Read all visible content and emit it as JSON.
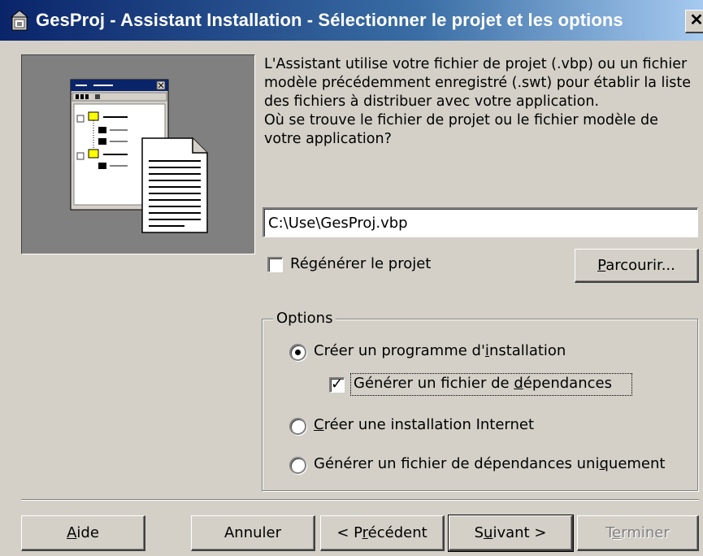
{
  "window": {
    "title": "GesProj - Assistant Installation - Sélectionner le projet et les options",
    "close_glyph": "✕"
  },
  "description": {
    "paragraph1": "L'Assistant utilise votre fichier de projet (.vbp) ou un fichier modèle précédemment enregistré (.swt) pour établir la liste des fichiers à distribuer avec votre application.",
    "paragraph2": "Où se trouve le fichier de projet ou le fichier modèle de votre application?"
  },
  "project_path": {
    "value": "C:\\Use\\GesProj.vbp"
  },
  "rebuild": {
    "label_pre": "Ré",
    "label_accel": "g",
    "label_post": "énérer le projet",
    "checked": false
  },
  "browse_button": {
    "label_accel": "P",
    "label_post": "arcourir..."
  },
  "options": {
    "title": "Options",
    "create_setup": {
      "label_pre": "Créer un programme d'",
      "label_accel": "i",
      "label_post": "nstallation",
      "selected": true
    },
    "gen_dependency": {
      "label_pre": "Générer un fichier de ",
      "label_accel": "d",
      "label_post": "épendances",
      "checked": true
    },
    "internet_setup": {
      "label_accel": "C",
      "label_post": "réer une installation Internet",
      "selected": false
    },
    "dependency_only": {
      "label_pre": "Générer un fichier de dépendances uni",
      "label_accel": "q",
      "label_post": "uement",
      "selected": false
    }
  },
  "buttons": {
    "help": {
      "label_accel": "A",
      "label_post": "ide"
    },
    "cancel": {
      "label": "Annuler"
    },
    "previous": {
      "label_pre": "< P",
      "label_accel": "r",
      "label_post": "écédent"
    },
    "next": {
      "label_pre": "S",
      "label_accel": "u",
      "label_post": "ivant >"
    },
    "finish": {
      "label_pre": "T",
      "label_accel": "e",
      "label_post": "rminer",
      "enabled": false
    }
  },
  "colors": {
    "dialog_face": "#d4d0c8",
    "title_gradient_start": "#0a246a",
    "title_gradient_end": "#a6caf0",
    "illustration_bg": "#808080"
  }
}
